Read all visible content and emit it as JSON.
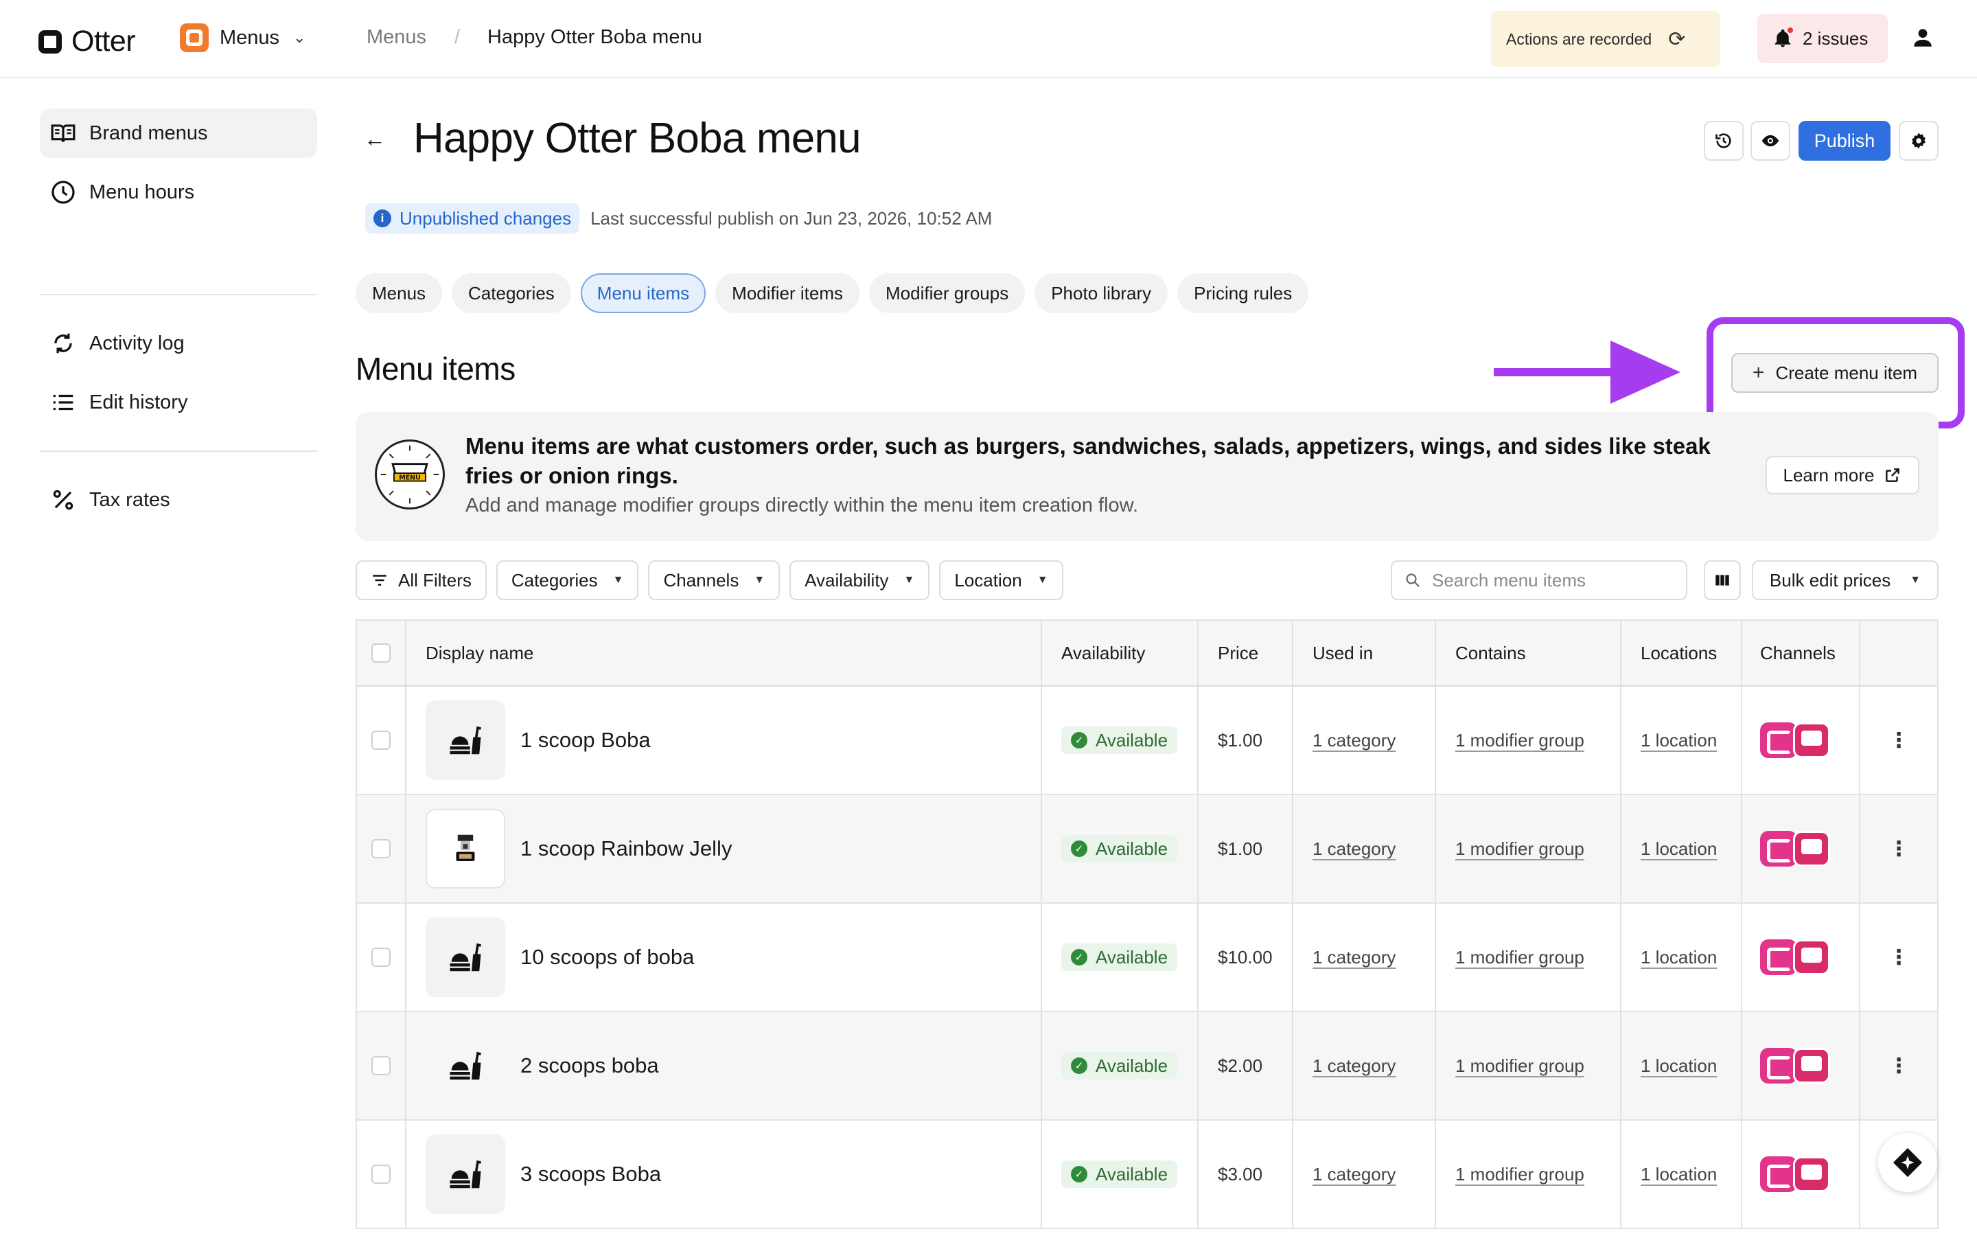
{
  "topbar": {
    "logo_text": "Otter",
    "app_label": "Menus",
    "breadcrumb": [
      "Menus",
      "/",
      "Happy Otter Boba menu"
    ],
    "recorded_text": "Actions are recorded",
    "issues_text": "2 issues"
  },
  "sidebar": {
    "items": [
      {
        "label": "Brand menus",
        "icon": "book-icon"
      },
      {
        "label": "Menu hours",
        "icon": "clock-icon"
      },
      {
        "label": "Activity log",
        "icon": "refresh-icon"
      },
      {
        "label": "Edit history",
        "icon": "list-icon"
      },
      {
        "label": "Tax rates",
        "icon": "percent-icon"
      }
    ]
  },
  "header": {
    "title": "Happy Otter Boba menu",
    "publish_label": "Publish",
    "unpublished_label": "Unpublished changes",
    "last_publish": "Last successful publish on Jun 23, 2026, 10:52 AM"
  },
  "tabs": [
    "Menus",
    "Categories",
    "Menu items",
    "Modifier items",
    "Modifier groups",
    "Photo library",
    "Pricing rules"
  ],
  "active_tab": "Menu items",
  "section": {
    "title": "Menu items",
    "create_label": "Create menu item"
  },
  "info": {
    "headline": "Menu items are what customers order, such as burgers, sandwiches, salads, appetizers, wings, and sides like steak fries or onion rings.",
    "subtext": "Add and manage modifier groups directly within the menu item creation flow.",
    "learn_more": "Learn more",
    "logo_text": "MENU"
  },
  "filters": {
    "all_filters": "All Filters",
    "dropdowns": [
      "Categories",
      "Channels",
      "Availability",
      "Location"
    ],
    "search_placeholder": "Search menu items",
    "bulk_edit": "Bulk edit prices"
  },
  "table": {
    "headers": [
      "Display name",
      "Availability",
      "Price",
      "Used in",
      "Contains",
      "Locations",
      "Channels"
    ],
    "rows": [
      {
        "name": "1 scoop Boba",
        "availability": "Available",
        "price": "$1.00",
        "used_in": "1 category",
        "contains": "1 modifier group",
        "locations": "1 location"
      },
      {
        "name": "1 scoop Rainbow Jelly",
        "availability": "Available",
        "price": "$1.00",
        "used_in": "1 category",
        "contains": "1 modifier group",
        "locations": "1 location"
      },
      {
        "name": "10 scoops of boba",
        "availability": "Available",
        "price": "$10.00",
        "used_in": "1 category",
        "contains": "1 modifier group",
        "locations": "1 location"
      },
      {
        "name": "2 scoops boba",
        "availability": "Available",
        "price": "$2.00",
        "used_in": "1 category",
        "contains": "1 modifier group",
        "locations": "1 location"
      },
      {
        "name": "3 scoops Boba",
        "availability": "Available",
        "price": "$3.00",
        "used_in": "1 category",
        "contains": "1 modifier group",
        "locations": "1 location"
      }
    ]
  },
  "colors": {
    "accent_blue": "#2f6fe0",
    "annotation_purple": "#a63cf0",
    "available_green": "#2e8b3a",
    "channel_pink": "#e2348a"
  }
}
